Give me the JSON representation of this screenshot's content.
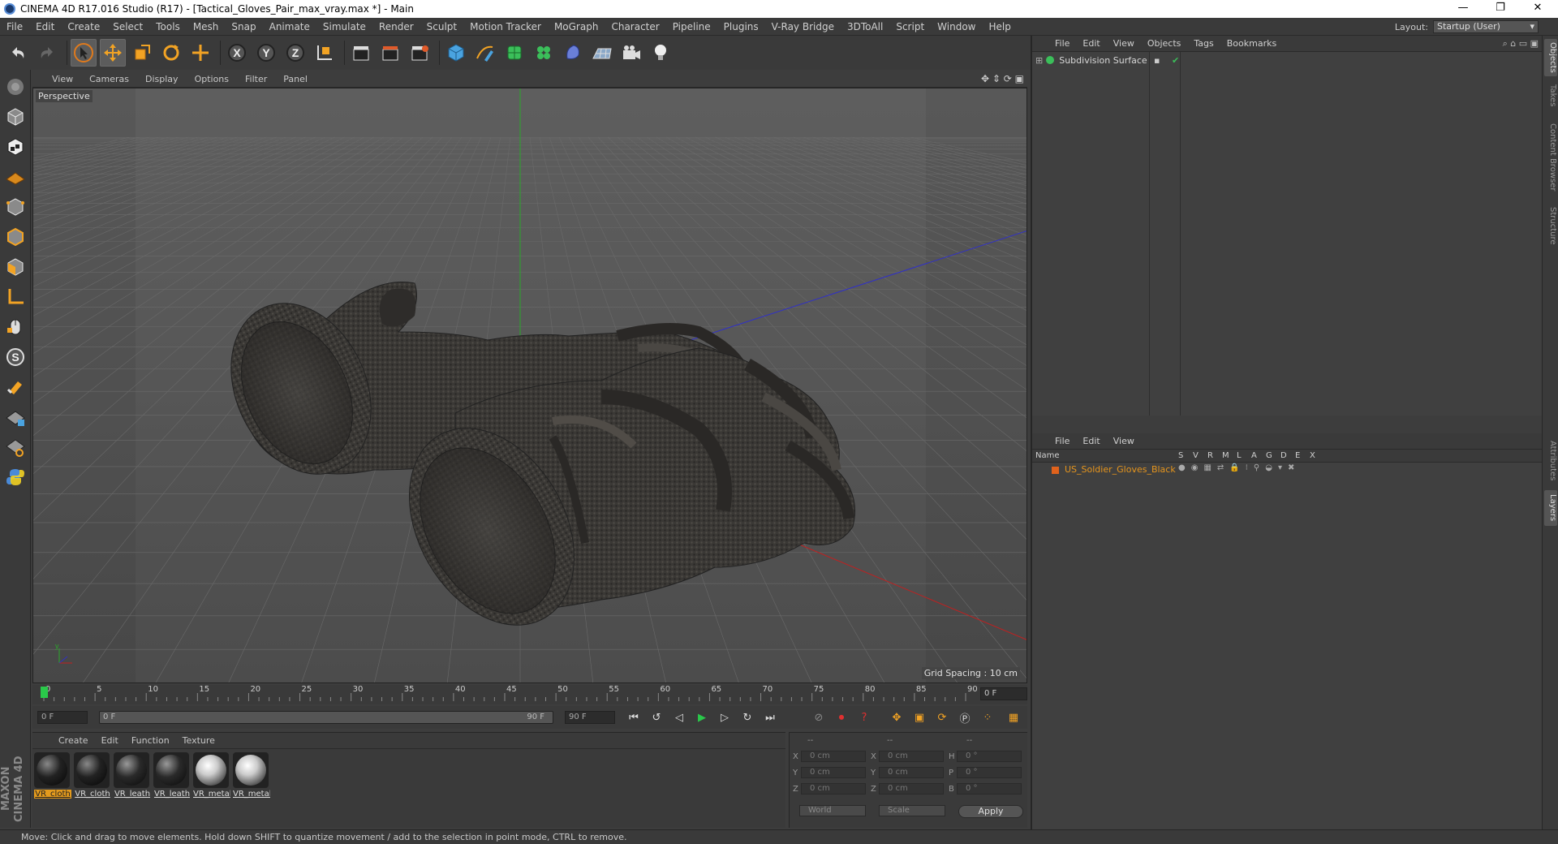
{
  "window": {
    "title": "CINEMA 4D R17.016 Studio (R17) - [Tactical_Gloves_Pair_max_vray.max *] - Main",
    "minimize": "—",
    "restore": "❐",
    "close": "✕"
  },
  "menu": [
    "File",
    "Edit",
    "Create",
    "Select",
    "Tools",
    "Mesh",
    "Snap",
    "Animate",
    "Simulate",
    "Render",
    "Sculpt",
    "Motion Tracker",
    "MoGraph",
    "Character",
    "Pipeline",
    "Plugins",
    "V-Ray Bridge",
    "3DToAll",
    "Script",
    "Window",
    "Help"
  ],
  "layout": {
    "label": "Layout:",
    "value": "Startup (User)"
  },
  "viewport": {
    "menu": [
      "View",
      "Cameras",
      "Display",
      "Options",
      "Filter",
      "Panel"
    ],
    "label": "Perspective",
    "grid_spacing": "Grid Spacing : 10 cm"
  },
  "timeline": {
    "ticks": [
      "0",
      "5",
      "10",
      "15",
      "20",
      "25",
      "30",
      "35",
      "40",
      "45",
      "50",
      "55",
      "60",
      "65",
      "70",
      "75",
      "80",
      "85",
      "90"
    ],
    "current_frame": "0 F",
    "start_field": "0 F",
    "range_start": "0 F",
    "range_end": "90 F",
    "end_field": "90 F"
  },
  "materials": {
    "menu": [
      "Create",
      "Edit",
      "Function",
      "Texture"
    ],
    "items": [
      {
        "name": "VR_cloth",
        "kind": "dark"
      },
      {
        "name": "VR_cloth",
        "kind": "dark"
      },
      {
        "name": "VR_leath",
        "kind": "dark"
      },
      {
        "name": "VR_leath",
        "kind": "dark"
      },
      {
        "name": "VR_metal",
        "kind": "light"
      },
      {
        "name": "VR_metal",
        "kind": "light"
      }
    ]
  },
  "coords": {
    "headers": [
      "--",
      "--",
      "--"
    ],
    "rows": [
      {
        "a": "X",
        "av": "0 cm",
        "b": "X",
        "bv": "0 cm",
        "c": "H",
        "cv": "0 °"
      },
      {
        "a": "Y",
        "av": "0 cm",
        "b": "Y",
        "bv": "0 cm",
        "c": "P",
        "cv": "0 °"
      },
      {
        "a": "Z",
        "av": "0 cm",
        "b": "Z",
        "bv": "0 cm",
        "c": "B",
        "cv": "0 °"
      }
    ],
    "mode1": "World",
    "mode2": "Scale",
    "apply": "Apply"
  },
  "status": "Move: Click and drag to move elements. Hold down SHIFT to quantize movement / add to the selection in point mode, CTRL to remove.",
  "objects": {
    "menu": [
      "File",
      "Edit",
      "View",
      "Objects",
      "Tags",
      "Bookmarks"
    ],
    "items": [
      {
        "name": "Subdivision Surface"
      }
    ]
  },
  "layers": {
    "menu": [
      "File",
      "Edit",
      "View"
    ],
    "head_name": "Name",
    "head_cols": [
      "S",
      "V",
      "R",
      "M",
      "L",
      "A",
      "G",
      "D",
      "E",
      "X"
    ],
    "items": [
      {
        "name": "US_Soldier_Gloves_Black",
        "color": "#e0621c"
      }
    ]
  },
  "side_tabs": [
    "Objects",
    "Takes",
    "Content Browser",
    "Structure",
    "Attributes",
    "Layers"
  ],
  "colors": {
    "accent": "#e39a1d",
    "axis_y": "#2aa82a",
    "axis_x": "#c02020",
    "axis_z": "#3030c8"
  }
}
